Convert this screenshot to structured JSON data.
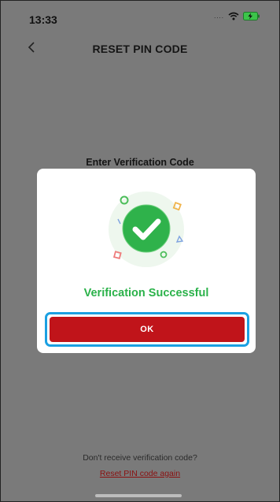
{
  "status_bar": {
    "time": "13:33",
    "signal": "....",
    "icons": [
      "wifi-icon",
      "battery-charging-icon"
    ]
  },
  "nav": {
    "title": "RESET PIN CODE",
    "back_icon": "chevron-left-icon"
  },
  "background": {
    "heading": "Enter Verification Code",
    "footer_hint": "Don't receive verification code?",
    "footer_link": "Reset PIN code again"
  },
  "modal": {
    "icon": "success-check-icon",
    "message": "Verification Successful",
    "ok_label": "OK"
  },
  "colors": {
    "overlay": "#7a7a7a",
    "success_green": "#2bb24a",
    "ok_red": "#c0141a",
    "focus_blue": "#1ba0e2",
    "link_red": "#8a1010"
  }
}
